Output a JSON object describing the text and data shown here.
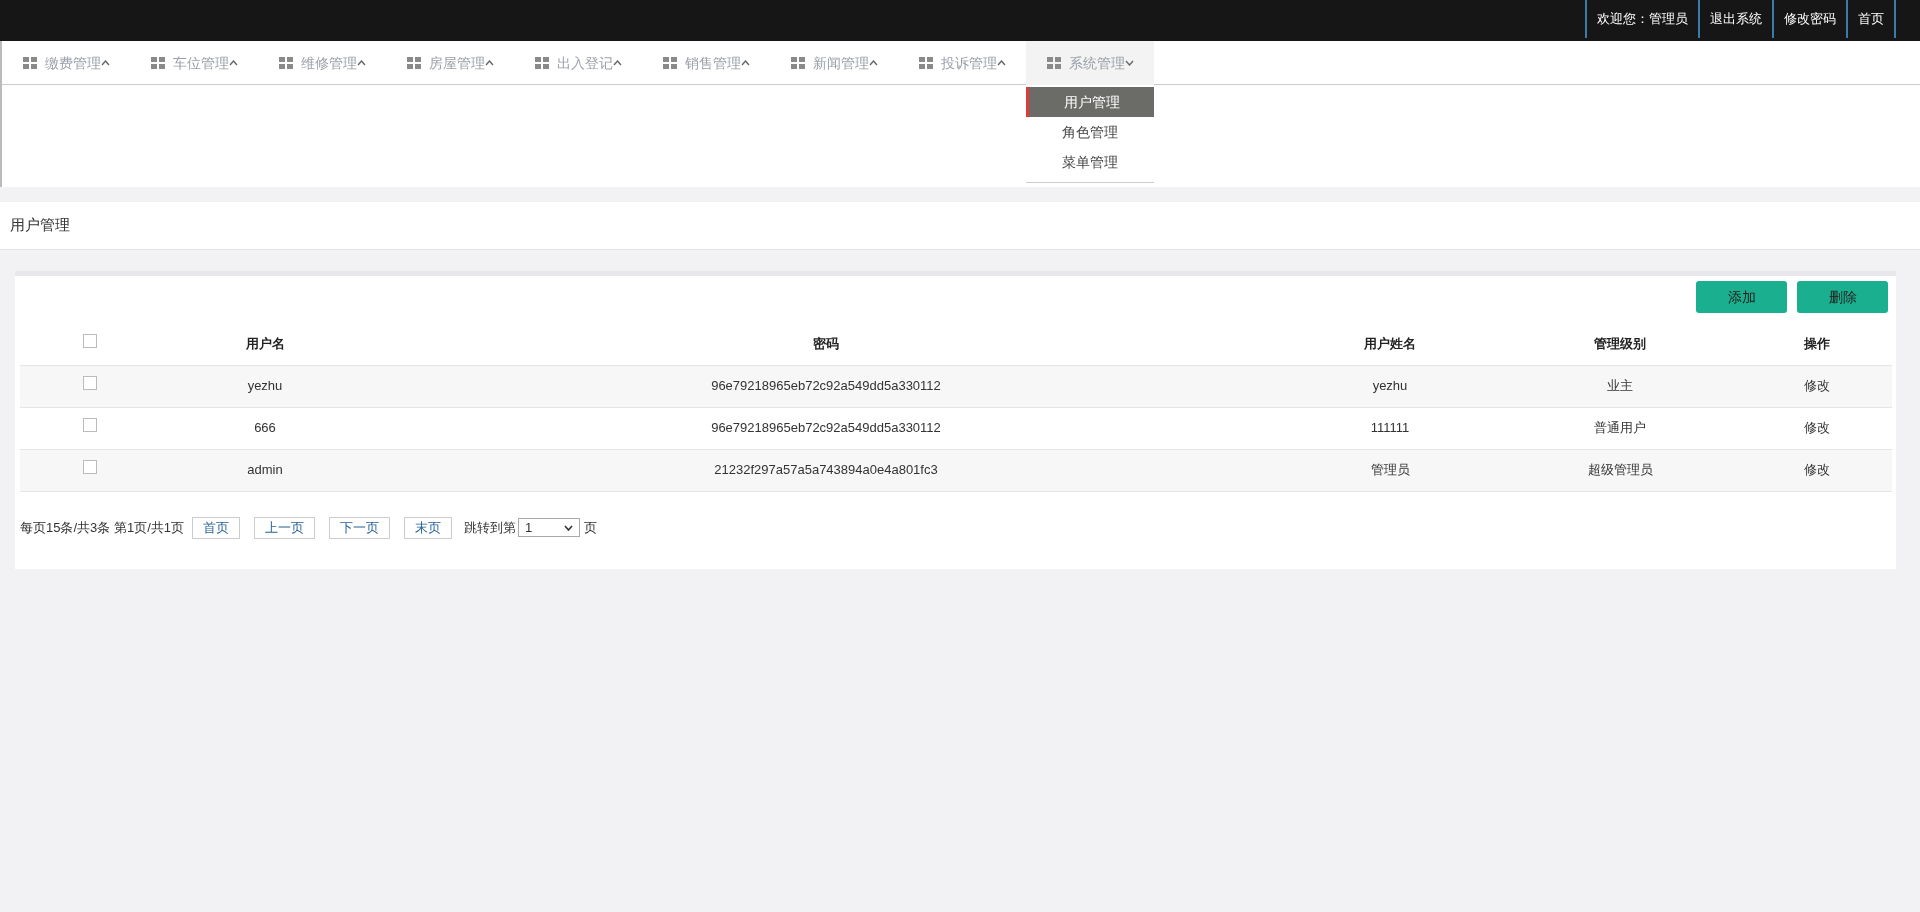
{
  "top_bar": {
    "links": [
      {
        "label": "欢迎您：管理员"
      },
      {
        "label": "退出系统"
      },
      {
        "label": "修改密码"
      },
      {
        "label": "首页"
      }
    ]
  },
  "nav": {
    "items": [
      {
        "label": "缴费管理",
        "expanded": false
      },
      {
        "label": "车位管理",
        "expanded": false
      },
      {
        "label": "维修管理",
        "expanded": false
      },
      {
        "label": "房屋管理",
        "expanded": false
      },
      {
        "label": "出入登记",
        "expanded": false
      },
      {
        "label": "销售管理",
        "expanded": false
      },
      {
        "label": "新闻管理",
        "expanded": false
      },
      {
        "label": "投诉管理",
        "expanded": false
      },
      {
        "label": "系统管理",
        "expanded": true,
        "children": [
          {
            "label": "用户管理",
            "selected": true
          },
          {
            "label": "角色管理",
            "selected": false
          },
          {
            "label": "菜单管理",
            "selected": false
          }
        ]
      }
    ]
  },
  "page_title": "用户管理",
  "toolbar": {
    "buttons": [
      "添加",
      "删除"
    ]
  },
  "table": {
    "header_checked": false,
    "columns": [
      "用户名",
      "密码",
      "用户姓名",
      "管理级别",
      "操作"
    ],
    "rows": [
      {
        "checked": false,
        "cells": [
          "yezhu",
          "96e79218965eb72c92a549dd5a330112",
          "yezhu",
          "业主"
        ],
        "action": "修改"
      },
      {
        "checked": false,
        "cells": [
          "666",
          "96e79218965eb72c92a549dd5a330112",
          "111111",
          "普通用户"
        ],
        "action": "修改"
      },
      {
        "checked": false,
        "cells": [
          "admin",
          "21232f297a57a5a743894a0e4a801fc3",
          "管理员",
          "超级管理员"
        ],
        "action": "修改"
      }
    ]
  },
  "pagination": {
    "summary": "每页15条/共3条 第1页/共1页",
    "links": [
      "首页",
      "上一页",
      "下一页",
      "末页"
    ],
    "jump_label": "跳转到第",
    "page_select": "1",
    "jump_suffix": "页"
  }
}
